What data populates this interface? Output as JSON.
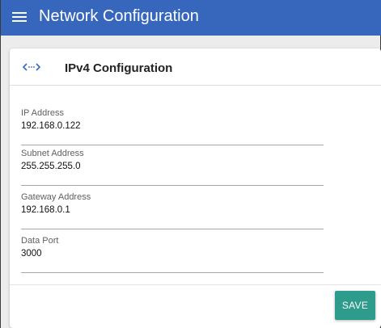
{
  "appbar": {
    "title": "Network Configuration",
    "menu_icon": "hamburger-menu-icon",
    "background": "#3767bd"
  },
  "card": {
    "icon": "code-brackets-icon",
    "title": "IPv4 Configuration",
    "fields": [
      {
        "label": "IP Address",
        "value": "192.168.0.122"
      },
      {
        "label": "Subnet Address",
        "value": "255.255.255.0"
      },
      {
        "label": "Gateway Address",
        "value": "192.168.0.1"
      },
      {
        "label": "Data Port",
        "value": "3000"
      }
    ],
    "save_label": "SAVE",
    "save_color": "#2e9c8c"
  }
}
